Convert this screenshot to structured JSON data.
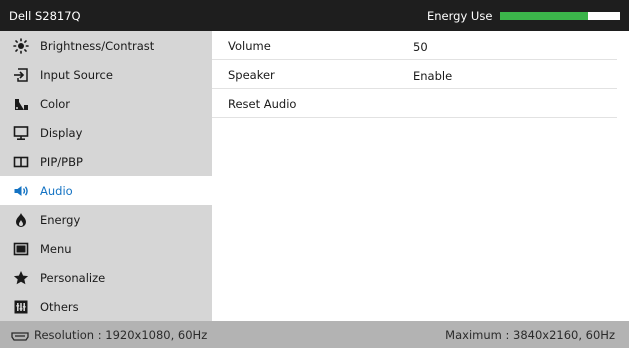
{
  "header": {
    "title": "Dell S2817Q",
    "energy_label": "Energy Use",
    "energy_level": 0.73,
    "energy_color": "#3bb54a"
  },
  "sidebar": {
    "items": [
      {
        "label": "Brightness/Contrast",
        "icon": "brightness-icon"
      },
      {
        "label": "Input Source",
        "icon": "input-source-icon"
      },
      {
        "label": "Color",
        "icon": "color-icon"
      },
      {
        "label": "Display",
        "icon": "display-icon"
      },
      {
        "label": "PIP/PBP",
        "icon": "pip-pbp-icon"
      },
      {
        "label": "Audio",
        "icon": "speaker-icon",
        "active": true
      },
      {
        "label": "Energy",
        "icon": "energy-icon"
      },
      {
        "label": "Menu",
        "icon": "menu-icon"
      },
      {
        "label": "Personalize",
        "icon": "star-icon"
      },
      {
        "label": "Others",
        "icon": "others-icon"
      }
    ]
  },
  "audio": {
    "rows": [
      {
        "name": "Volume",
        "value": "50"
      },
      {
        "name": "Speaker",
        "value": "Enable"
      },
      {
        "name": "Reset Audio",
        "value": ""
      }
    ]
  },
  "footer": {
    "resolution": "Resolution : 1920x1080, 60Hz",
    "maximum": "Maximum : 3840x2160, 60Hz"
  },
  "colors": {
    "accent": "#1473c3",
    "header_bg": "#1e1e1e",
    "sidebar_bg": "#d6d6d6",
    "footer_bg": "#b3b3b3"
  }
}
